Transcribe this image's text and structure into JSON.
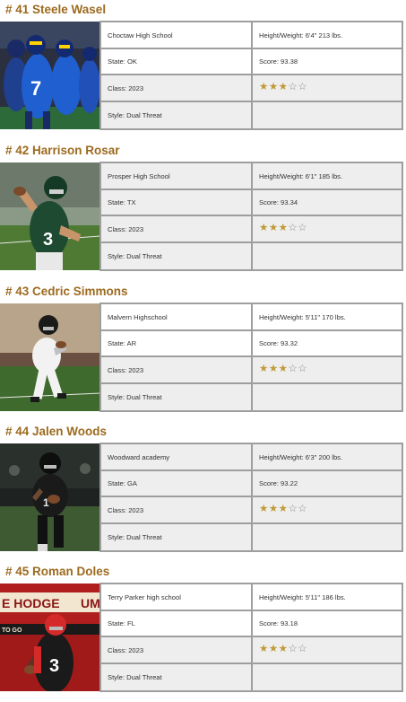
{
  "players": [
    {
      "title": "# 41 Steele Wasel",
      "school": "Choctaw High School",
      "height_weight": "Height/Weight: 6'4\"  213 lbs.",
      "state": "State: OK",
      "score": "Score: 93.38",
      "class": "Class: 2023",
      "style": "Style: Dual Threat",
      "stars": {
        "filled": 3,
        "total": 5
      },
      "photo": {
        "kind": "blue-team",
        "colors": {
          "bg": "#1f3f8f",
          "jersey": "#1f5fd0",
          "accent": "#ffd200"
        }
      }
    },
    {
      "title": "# 42 Harrison Rosar",
      "school": "Prosper High School",
      "height_weight": "Height/Weight: 6'1\"  185 lbs.",
      "state": "State: TX",
      "score": "Score: 93.34",
      "class": "Class: 2023",
      "style": "Style: Dual Threat",
      "stars": {
        "filled": 3,
        "total": 5
      },
      "photo": {
        "kind": "green-throw",
        "colors": {
          "bg": "#6b8c4a",
          "jersey": "#1f4a32",
          "accent": "#ffffff"
        }
      }
    },
    {
      "title": "# 43 Cedric Simmons",
      "school": "Malvern Highschool",
      "height_weight": "Height/Weight: 5'11\"  170 lbs.",
      "state": "State: AR",
      "score": "Score: 93.32",
      "class": "Class: 2023",
      "style": "Style: Dual Threat",
      "stars": {
        "filled": 3,
        "total": 5
      },
      "photo": {
        "kind": "white-run",
        "colors": {
          "bg": "#7a6a5a",
          "jersey": "#f2f2f2",
          "accent": "#1a1a1a"
        }
      }
    },
    {
      "title": "# 44 Jalen Woods",
      "school": "Woodward academy",
      "height_weight": "Height/Weight: 6'3\"  200 lbs.",
      "state": "State: GA",
      "score": "Score: 93.22",
      "class": "Class: 2023",
      "style": "Style: Dual Threat",
      "stars": {
        "filled": 3,
        "total": 5
      },
      "photo": {
        "kind": "dark-field",
        "colors": {
          "bg": "#3d4a3a",
          "jersey": "#1a1a1a",
          "accent": "#e8e8e8"
        }
      }
    },
    {
      "title": "# 45 Roman Doles",
      "school": "Terry Parker high school",
      "height_weight": "Height/Weight: 5'11\"  186 lbs.",
      "state": "State: FL",
      "score": "Score: 93.18",
      "class": "Class: 2023",
      "style": "Style: Dual Threat",
      "stars": {
        "filled": 3,
        "total": 5
      },
      "photo": {
        "kind": "red-stadium",
        "colors": {
          "bg": "#b01e1e",
          "jersey": "#1a1a1a",
          "accent": "#d42a2a"
        },
        "sign_text": "E HODGE",
        "sign_text_2": "UM",
        "sign_text_3": "TO GO",
        "jersey_number": "3"
      }
    }
  ]
}
